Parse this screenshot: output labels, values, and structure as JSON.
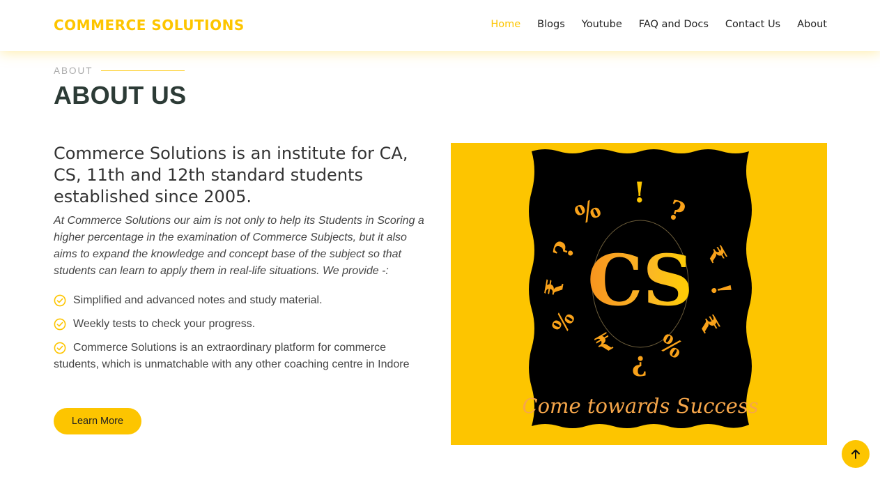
{
  "header": {
    "brand": "COMMERCE SOLUTIONS",
    "nav": [
      {
        "label": "Home",
        "active": true
      },
      {
        "label": "Blogs",
        "active": false
      },
      {
        "label": "Youtube",
        "active": false
      },
      {
        "label": "FAQ and Docs",
        "active": false
      },
      {
        "label": "Contact Us",
        "active": false
      },
      {
        "label": "About",
        "active": false
      }
    ]
  },
  "about": {
    "section_label": "ABOUT",
    "title": "ABOUT US",
    "heading": "Commerce Solutions is an institute for CA, CS, 11th and 12th standard students established since 2005.",
    "intro": "At Commerce Solutions our aim is not only to help its Students in Scoring a higher percentage in the examination of Commerce Subjects, but it also aims to expand the knowledge and concept base of the subject so that students can learn to apply them in real-life situations. We provide -:",
    "features": [
      "Simplified and advanced notes and study material.",
      "Weekly tests to check your progress.",
      "Commerce Solutions is an extraordinary platform for commerce students, which is unmatchable with any other coaching centre in Indore"
    ],
    "button_label": "Learn More"
  },
  "image": {
    "logo_text": "CS",
    "tagline": "Come towards Success",
    "background_color": "#fdc500",
    "panel_color": "#000000"
  },
  "colors": {
    "accent": "#fdc500",
    "title": "#2c3b36",
    "text": "#444444"
  },
  "icons": {
    "feature": "check-circle-icon",
    "back_to_top": "arrow-up-icon"
  }
}
